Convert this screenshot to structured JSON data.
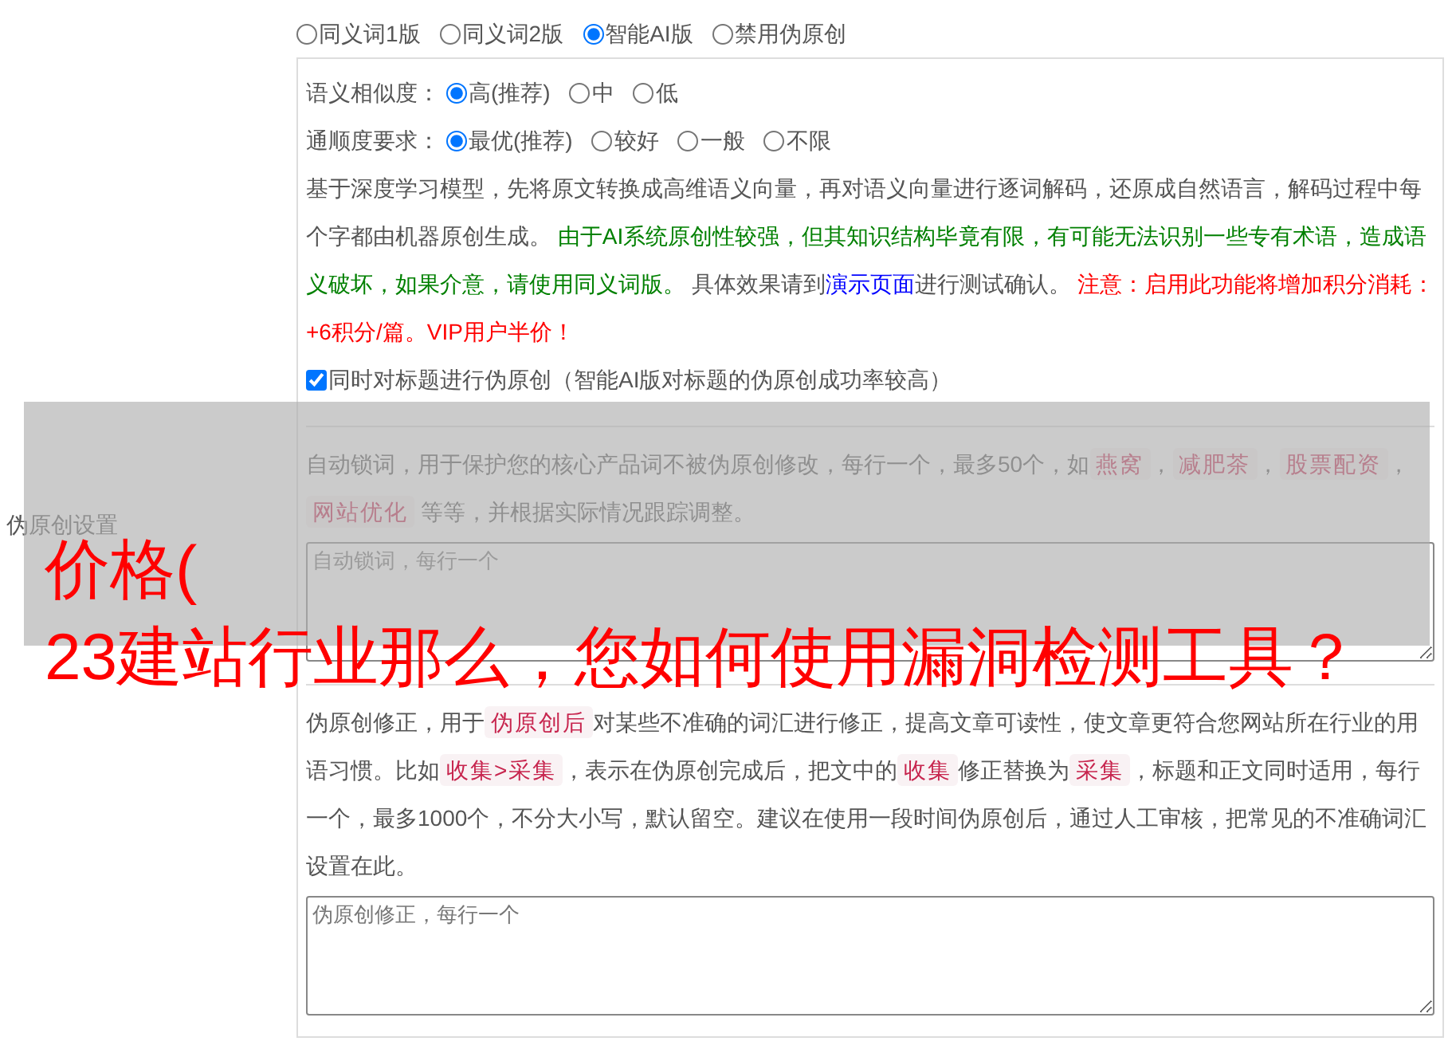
{
  "versions": [
    {
      "label": "同义词1版",
      "selected": false
    },
    {
      "label": "同义词2版",
      "selected": false
    },
    {
      "label": "智能AI版",
      "selected": true
    },
    {
      "label": "禁用伪原创",
      "selected": false
    }
  ],
  "settings": [
    {
      "label": "语义相似度：",
      "options": [
        {
          "label": "高(推荐)",
          "selected": true
        },
        {
          "label": "中",
          "selected": false
        },
        {
          "label": "低",
          "selected": false
        }
      ]
    },
    {
      "label": "通顺度要求：",
      "options": [
        {
          "label": "最优(推荐)",
          "selected": true
        },
        {
          "label": "较好",
          "selected": false
        },
        {
          "label": "一般",
          "selected": false
        },
        {
          "label": "不限",
          "selected": false
        }
      ]
    }
  ],
  "description": [
    {
      "kind": "text",
      "text": "基于深度学习模型，先将原文转换成高维语义向量，再对语义向量进行逐词解码，还原成自然语言，解码过程中每个字都由机器原创生成。 "
    },
    {
      "kind": "note",
      "text": "由于AI系统原创性较强，但其知识结构毕竟有限，有可能无法识别一些专有术语，造成语义破坏，如果介意，请使用同义词版。"
    },
    {
      "kind": "text",
      "text": " 具体效果请到"
    },
    {
      "kind": "link",
      "text": "演示页面"
    },
    {
      "kind": "text",
      "text": "进行测试确认。 "
    },
    {
      "kind": "warning",
      "text": "注意：启用此功能将增加积分消耗：+6积分/篇。VIP用户半价！"
    }
  ],
  "title_option": {
    "label": "同时对标题进行伪原创（智能AI版对标题的伪原创成功率较高）",
    "checked": true
  },
  "section_label": "伪原创设置",
  "lock_words": {
    "description": [
      {
        "kind": "text",
        "text": "自动锁词，用于保护您的核心产品词不被伪原创修改，每行一个，最多50个，如"
      },
      {
        "kind": "tag",
        "text": "燕窝"
      },
      {
        "kind": "text",
        "text": "，"
      },
      {
        "kind": "tag",
        "text": "减肥茶"
      },
      {
        "kind": "text",
        "text": "，"
      },
      {
        "kind": "tag",
        "text": "股票配资"
      },
      {
        "kind": "text",
        "text": "，"
      },
      {
        "kind": "tag",
        "text": "网站优化"
      },
      {
        "kind": "text",
        "text": " 等等，并根据实际情况跟踪调整。"
      }
    ],
    "placeholder": "自动锁词，每行一个"
  },
  "corrections": {
    "description": [
      {
        "kind": "text",
        "text": "伪原创修正，用于"
      },
      {
        "kind": "tag",
        "text": "伪原创后"
      },
      {
        "kind": "text",
        "text": "对某些不准确的词汇进行修正，提高文章可读性，使文章更符合您网站所在行业的用语习惯。比如"
      },
      {
        "kind": "tag",
        "text": "收集>采集"
      },
      {
        "kind": "text",
        "text": "，表示在伪原创完成后，把文中的"
      },
      {
        "kind": "tag",
        "text": "收集"
      },
      {
        "kind": "text",
        "text": "修正替换为"
      },
      {
        "kind": "tag",
        "text": "采集"
      },
      {
        "kind": "text",
        "text": "，标题和正文同时适用，每行一个，最多1000个，不分大小写，默认留空。建议在使用一段时间伪原创后，通过人工审核，把常见的不准确词汇设置在此。"
      }
    ],
    "placeholder": "伪原创修正，每行一个"
  },
  "overlay": {
    "lines": [
      "价格(",
      "23建站行业那么，您如何使用漏洞检测工具？"
    ]
  }
}
